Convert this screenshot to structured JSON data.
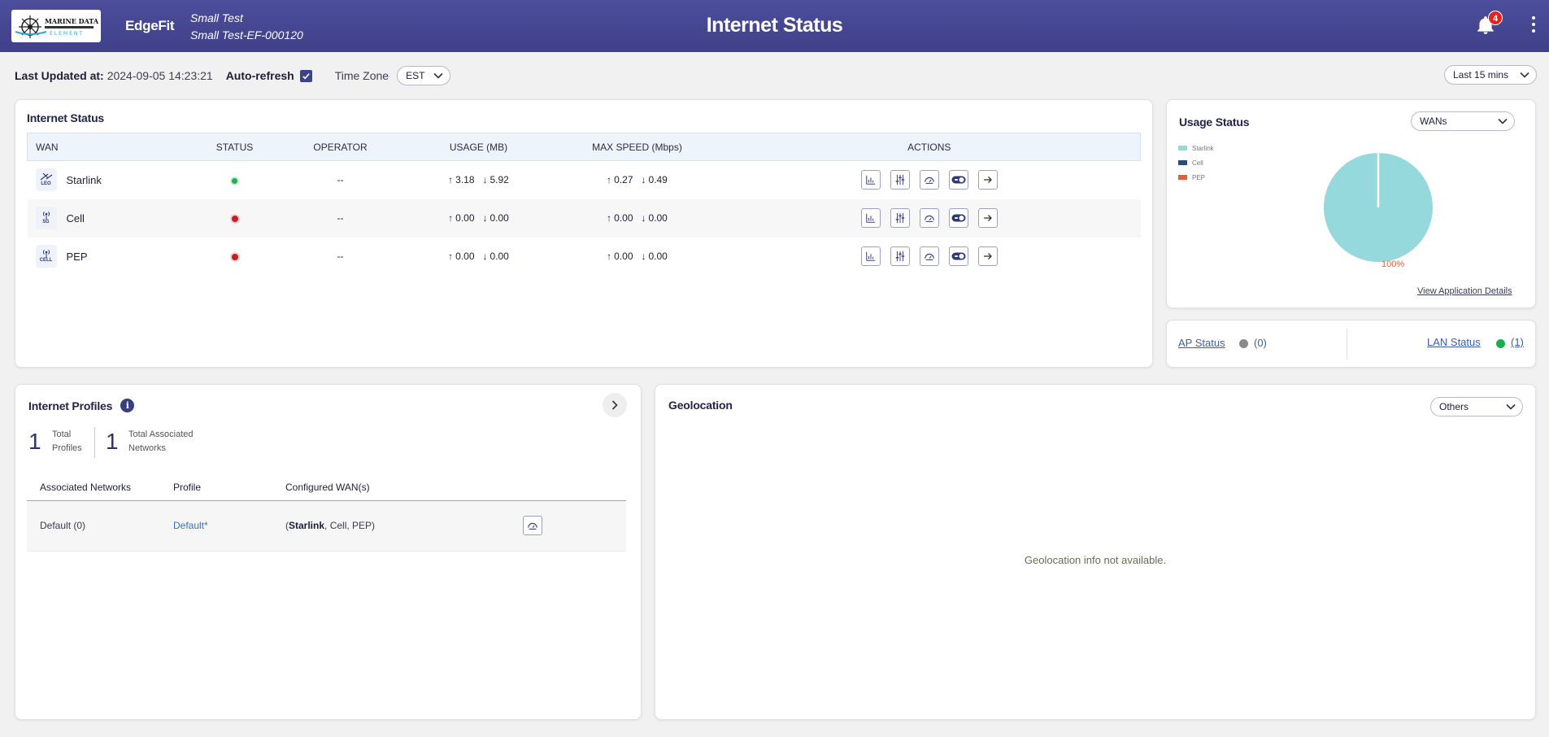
{
  "header": {
    "brand": "EdgeFit",
    "site_name": "Small Test",
    "site_id": "Small Test-EF-000120",
    "title": "Internet Status",
    "notifications_count": "4"
  },
  "toolbar": {
    "last_updated_label": "Last Updated at:",
    "last_updated_value": "2024-09-05 14:23:21",
    "auto_refresh_label": "Auto-refresh",
    "auto_refresh_checked": true,
    "timezone_label": "Time Zone",
    "timezone_value": "EST",
    "time_range": "Last 15 mins"
  },
  "internet_status": {
    "title": "Internet Status",
    "columns": [
      "WAN",
      "STATUS",
      "OPERATOR",
      "USAGE (MB)",
      "MAX SPEED (Mbps)",
      "ACTIONS"
    ],
    "rows": [
      {
        "icon_label": "LEO",
        "name": "Starlink",
        "status": "up",
        "operator": "--",
        "usage_up": "3.18",
        "usage_down": "5.92",
        "speed_up": "0.27",
        "speed_down": "0.49"
      },
      {
        "icon_label": "5G",
        "name": "Cell",
        "status": "down",
        "operator": "--",
        "usage_up": "0.00",
        "usage_down": "0.00",
        "speed_up": "0.00",
        "speed_down": "0.00"
      },
      {
        "icon_label": "CELL",
        "name": "PEP",
        "status": "down",
        "operator": "--",
        "usage_up": "0.00",
        "usage_down": "0.00",
        "speed_up": "0.00",
        "speed_down": "0.00"
      }
    ]
  },
  "usage_status": {
    "title": "Usage Status",
    "filter": "WANs",
    "legend": [
      {
        "name": "Starlink",
        "color": "#96d9dd"
      },
      {
        "name": "Cell",
        "color": "#1f4e8c"
      },
      {
        "name": "PEP",
        "color": "#e0603a"
      }
    ],
    "pie_label": "100%",
    "details_link": "View Application Details"
  },
  "ap_lan": {
    "ap_label": "AP Status",
    "ap_count": "(0)",
    "lan_label": "LAN Status",
    "lan_count": "(1)"
  },
  "profiles": {
    "title": "Internet Profiles",
    "total_profiles": "1",
    "total_profiles_label_1": "Total",
    "total_profiles_label_2": "Profiles",
    "total_networks": "1",
    "total_networks_label_1": "Total Associated",
    "total_networks_label_2": "Networks",
    "columns": [
      "Associated Networks",
      "Profile",
      "Configured WAN(s)"
    ],
    "rows": [
      {
        "network": "Default (0)",
        "profile": "Default*",
        "wan_primary": "Starlink",
        "wan_others": "Cell, PEP"
      }
    ]
  },
  "geolocation": {
    "title": "Geolocation",
    "filter": "Others",
    "empty_message": "Geolocation info not available."
  },
  "colors": {
    "header": "#4546926",
    "accent": "#3e4388",
    "up": "#20b050",
    "down": "#c81e1e"
  }
}
